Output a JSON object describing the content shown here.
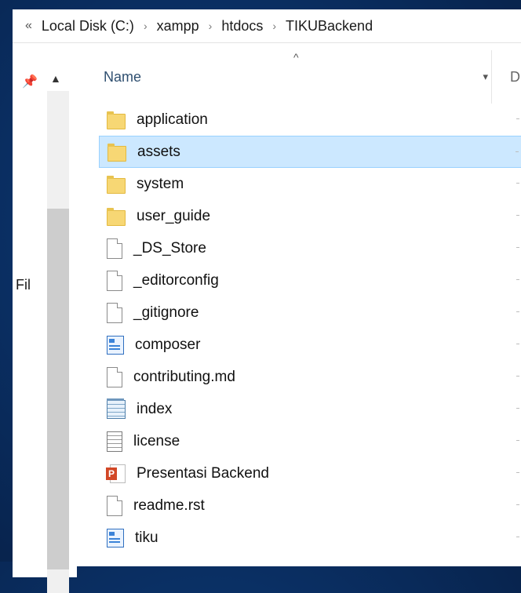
{
  "breadcrumb": {
    "overflow": "«",
    "items": [
      "Local Disk (C:)",
      "xampp",
      "htdocs",
      "TIKUBackend"
    ],
    "separator": "›"
  },
  "nav": {
    "pin_icon": "pin-icon",
    "collapse_icon": "chevron-up-icon",
    "visible_label": "Fil"
  },
  "columns": {
    "name_label": "Name",
    "sort_icon": "sort-up-arrow-icon",
    "next_column_partial": "D"
  },
  "files": [
    {
      "name": "application",
      "icon": "folder-icon",
      "selected": false
    },
    {
      "name": "assets",
      "icon": "folder-icon",
      "selected": true
    },
    {
      "name": "system",
      "icon": "folder-icon",
      "selected": false
    },
    {
      "name": "user_guide",
      "icon": "folder-icon",
      "selected": false
    },
    {
      "name": "_DS_Store",
      "icon": "file-icon",
      "selected": false
    },
    {
      "name": "_editorconfig",
      "icon": "file-icon",
      "selected": false
    },
    {
      "name": "_gitignore",
      "icon": "file-icon",
      "selected": false
    },
    {
      "name": "composer",
      "icon": "app-file-icon",
      "selected": false
    },
    {
      "name": "contributing.md",
      "icon": "file-icon",
      "selected": false
    },
    {
      "name": "index",
      "icon": "notepad-file-icon",
      "selected": false
    },
    {
      "name": "license",
      "icon": "text-file-icon",
      "selected": false
    },
    {
      "name": "Presentasi Backend",
      "icon": "powerpoint-file-icon",
      "selected": false
    },
    {
      "name": "readme.rst",
      "icon": "file-icon",
      "selected": false
    },
    {
      "name": "tiku",
      "icon": "app-file-icon",
      "selected": false
    }
  ],
  "colors": {
    "selection_background": "#cce8ff",
    "selection_border": "#99d1ff",
    "desktop_background": "#0a2f63",
    "folder_yellow": "#f7d774"
  }
}
